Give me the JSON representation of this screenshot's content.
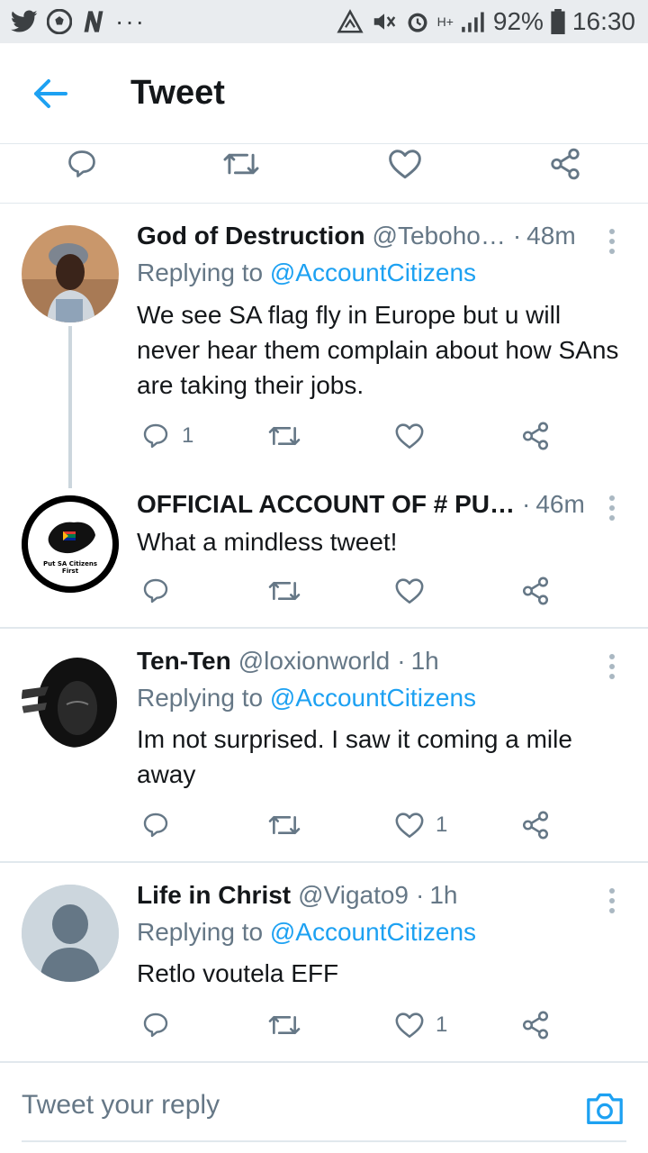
{
  "status_bar": {
    "battery": "92%",
    "time": "16:30",
    "network": "H+"
  },
  "header": {
    "title": "Tweet"
  },
  "tweets": [
    {
      "name": "God of Destruction",
      "handle": "@Teboho…",
      "time": "48m",
      "replying_label": "Replying to",
      "replying_to": "@AccountCitizens",
      "text": "We see SA flag fly in Europe but u will never hear them complain about how SAns are taking their jobs.",
      "reply_count": "1",
      "like_count": ""
    },
    {
      "name": "OFFICIAL ACCOUNT OF # PU…",
      "handle": "",
      "time": "46m",
      "text": "What a mindless tweet!",
      "avatar_text": "Put SA Citizens First"
    },
    {
      "name": "Ten-Ten",
      "handle": "@loxionworld",
      "time": "1h",
      "replying_label": "Replying to",
      "replying_to": "@AccountCitizens",
      "text": "Im not surprised. I saw it coming a mile away",
      "like_count": "1"
    },
    {
      "name": "Life in Christ",
      "handle": "@Vigato9",
      "time": "1h",
      "replying_label": "Replying to",
      "replying_to": "@AccountCitizens",
      "text": "Retlo voutela EFF",
      "like_count": "1"
    }
  ],
  "reply_box": {
    "placeholder": "Tweet your reply"
  },
  "colors": {
    "accent": "#1da1f2",
    "muted": "#657786",
    "text": "#14171a",
    "divider": "#e1e8ed"
  }
}
